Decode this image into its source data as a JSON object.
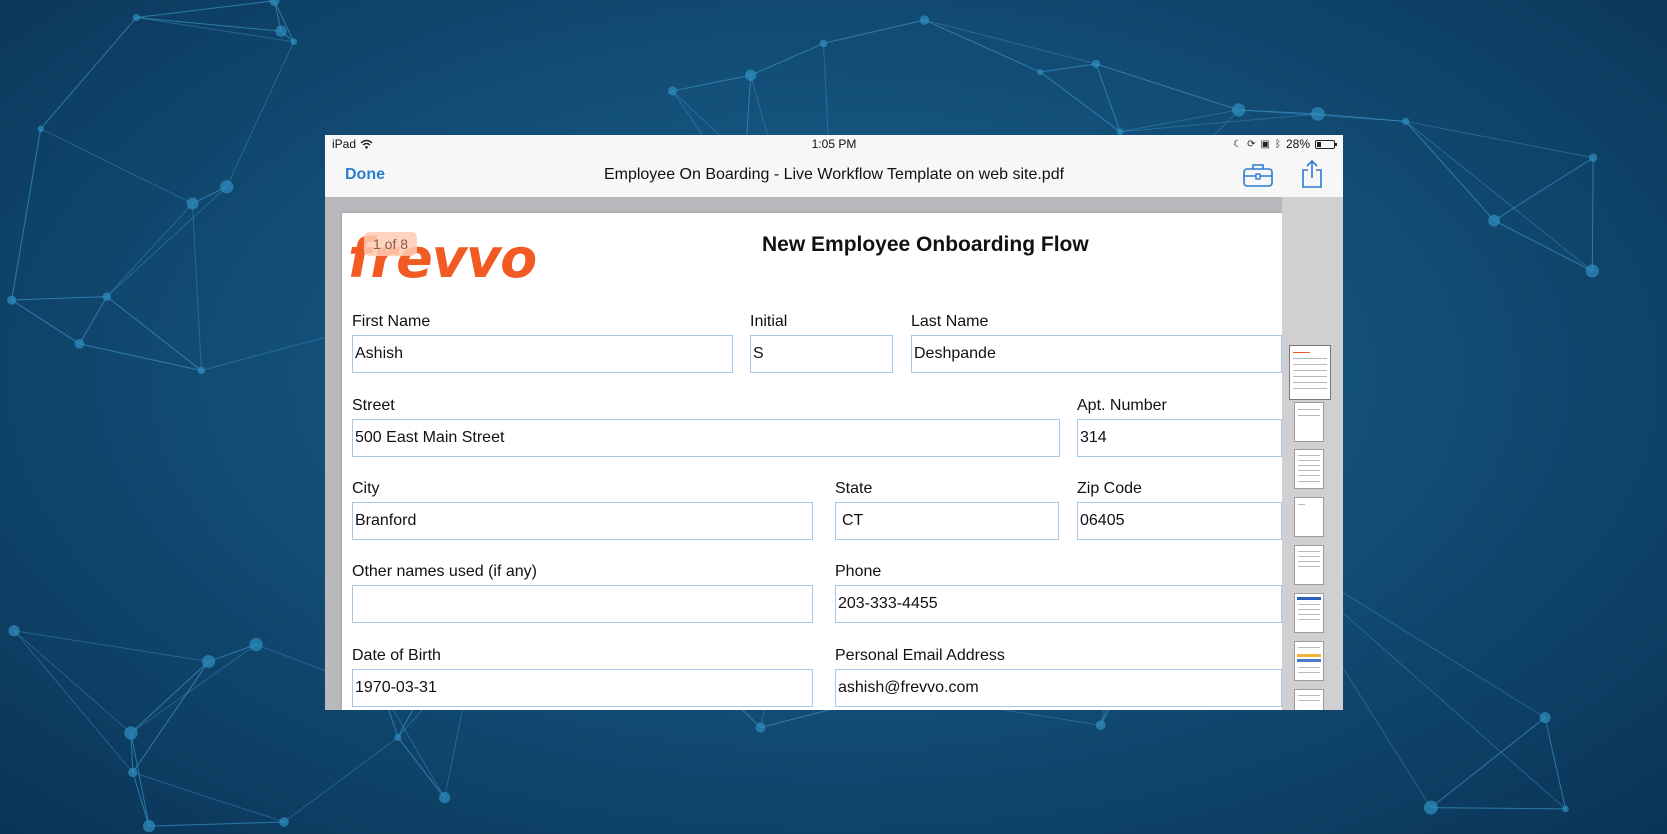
{
  "status_bar": {
    "device": "iPad",
    "time": "1:05 PM",
    "battery": "28%",
    "battery_level": 0.28
  },
  "nav": {
    "done_label": "Done",
    "title": "Employee On Boarding - Live Workflow Template on web site.pdf"
  },
  "viewer": {
    "page_indicator": "1 of 8",
    "logo_text": "frevvo",
    "form_title": "New Employee Onboarding Flow"
  },
  "form": {
    "first_name": {
      "label": "First Name",
      "value": "Ashish"
    },
    "initial": {
      "label": "Initial",
      "value": "S"
    },
    "last_name": {
      "label": "Last Name",
      "value": "Deshpande"
    },
    "street": {
      "label": "Street",
      "value": "500 East Main Street"
    },
    "apt": {
      "label": "Apt. Number",
      "value": "314"
    },
    "city": {
      "label": "City",
      "value": "Branford"
    },
    "state": {
      "label": "State",
      "value": "CT"
    },
    "zip": {
      "label": "Zip Code",
      "value": "06405"
    },
    "other_names": {
      "label": "Other names used (if any)",
      "value": ""
    },
    "phone": {
      "label": "Phone",
      "value": "203-333-4455"
    },
    "dob": {
      "label": "Date of Birth",
      "value": "1970-03-31"
    },
    "email": {
      "label": "Personal Email Address",
      "value": "ashish@frevvo.com"
    }
  },
  "colors": {
    "accent": "#2b7cd3",
    "logo": "#f15a22",
    "field_border": "#a9c7e6",
    "background": "#134f78"
  },
  "icons": [
    "wifi-icon",
    "moon-icon",
    "lock-rotation-icon",
    "airplay-icon",
    "bluetooth-icon",
    "battery-icon",
    "toolbox-icon",
    "share-icon"
  ]
}
